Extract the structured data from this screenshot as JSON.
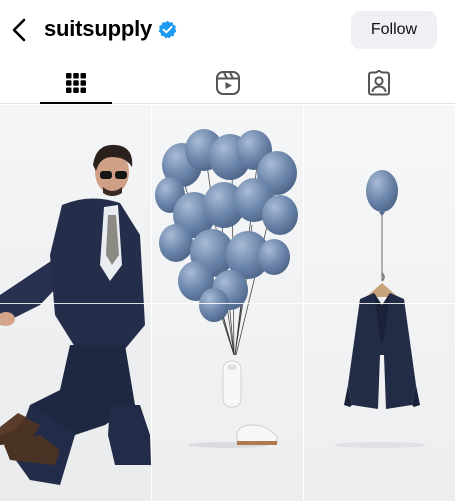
{
  "header": {
    "back_icon": "chevron-left-icon",
    "username": "suitsupply",
    "verified_icon": "verified-badge-icon",
    "verified_color": "#1d9bf0",
    "follow_label": "Follow"
  },
  "tabs": [
    {
      "icon": "grid-icon",
      "active": true
    },
    {
      "icon": "reels-icon",
      "active": false
    },
    {
      "icon": "tagged-icon",
      "active": false
    }
  ],
  "posts": [
    {
      "description": "photo"
    },
    {
      "description": "photo"
    },
    {
      "description": "photo"
    }
  ]
}
